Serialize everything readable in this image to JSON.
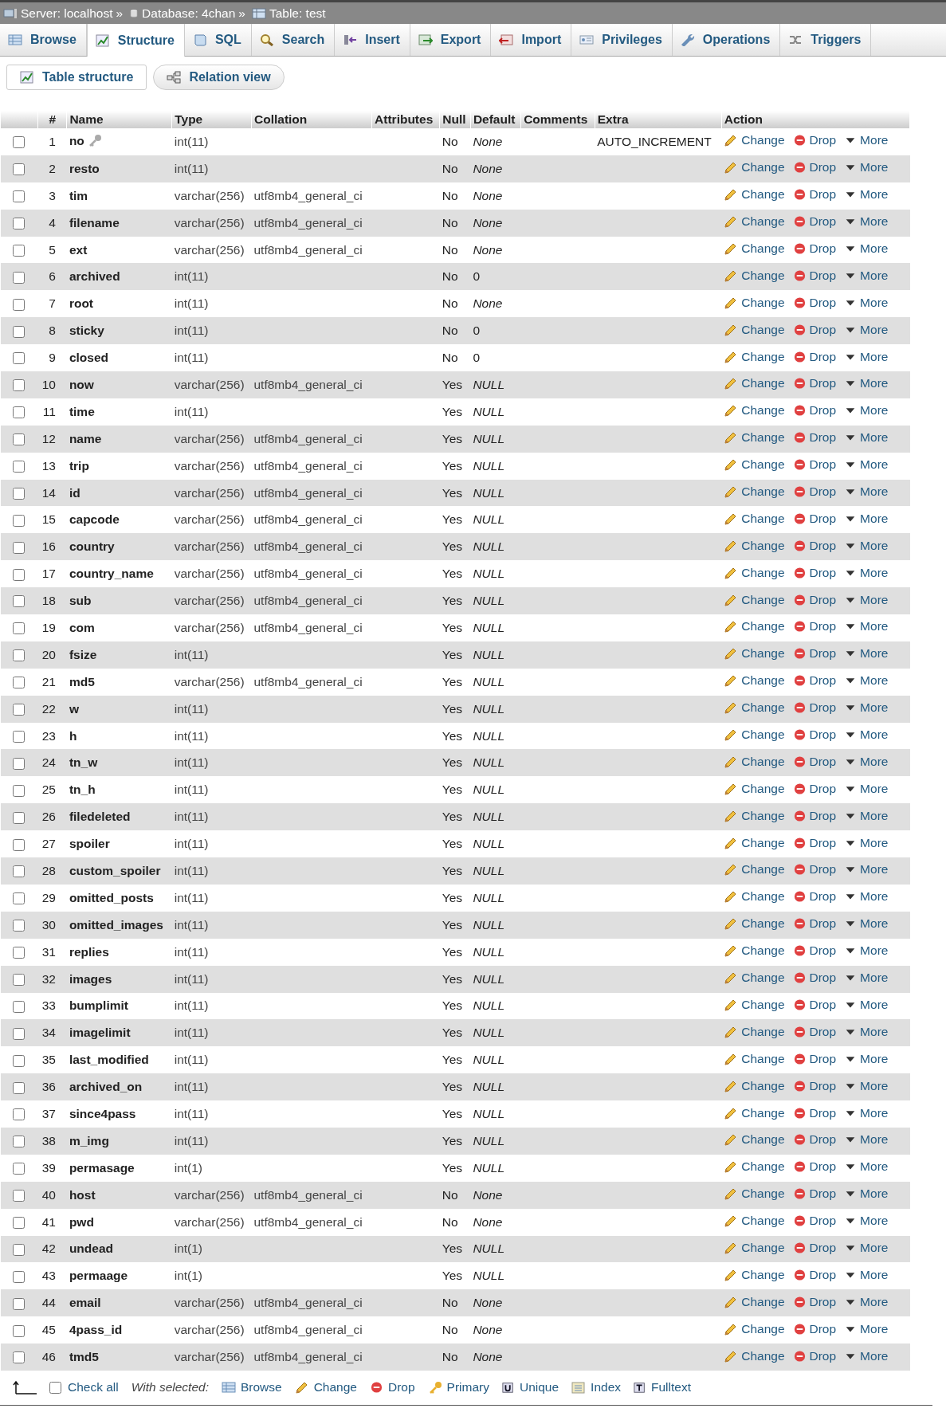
{
  "breadcrumb": [
    {
      "label": "Server: localhost",
      "kind": "server"
    },
    {
      "label": "Database: 4chan",
      "kind": "database"
    },
    {
      "label": "Table: test",
      "kind": "table"
    }
  ],
  "breadcrumb_separator": "»",
  "tabs": [
    {
      "label": "Browse",
      "selected": false
    },
    {
      "label": "Structure",
      "selected": true
    },
    {
      "label": "SQL",
      "selected": false
    },
    {
      "label": "Search",
      "selected": false
    },
    {
      "label": "Insert",
      "selected": false
    },
    {
      "label": "Export",
      "selected": false
    },
    {
      "label": "Import",
      "selected": false
    },
    {
      "label": "Privileges",
      "selected": false
    },
    {
      "label": "Operations",
      "selected": false
    },
    {
      "label": "Triggers",
      "selected": false
    }
  ],
  "subtabs": [
    {
      "label": "Table structure",
      "selected": true
    },
    {
      "label": "Relation view",
      "selected": false
    }
  ],
  "table": {
    "columns": [
      "#",
      "Name",
      "Type",
      "Collation",
      "Attributes",
      "Null",
      "Default",
      "Comments",
      "Extra",
      "Action"
    ],
    "rows": [
      {
        "num": "1",
        "name": "no",
        "type": "int(11)",
        "null": "No",
        "default": "None",
        "default_italic": true,
        "extra": "AUTO_INCREMENT",
        "primary": true,
        "checked": false,
        "change": "Change",
        "drop": "Drop",
        "more": "More"
      },
      {
        "num": "2",
        "name": "resto",
        "type": "int(11)",
        "null": "No",
        "default": "None",
        "default_italic": true,
        "primary": false,
        "checked": false,
        "change": "Change",
        "drop": "Drop",
        "more": "More"
      },
      {
        "num": "3",
        "name": "tim",
        "type": "varchar(256)",
        "collation": "utf8mb4_general_ci",
        "null": "No",
        "default": "None",
        "default_italic": true,
        "primary": false,
        "checked": false,
        "change": "Change",
        "drop": "Drop",
        "more": "More"
      },
      {
        "num": "4",
        "name": "filename",
        "type": "varchar(256)",
        "collation": "utf8mb4_general_ci",
        "null": "No",
        "default": "None",
        "default_italic": true,
        "primary": false,
        "checked": false,
        "change": "Change",
        "drop": "Drop",
        "more": "More"
      },
      {
        "num": "5",
        "name": "ext",
        "type": "varchar(256)",
        "collation": "utf8mb4_general_ci",
        "null": "No",
        "default": "None",
        "default_italic": true,
        "primary": false,
        "checked": false,
        "change": "Change",
        "drop": "Drop",
        "more": "More"
      },
      {
        "num": "6",
        "name": "archived",
        "type": "int(11)",
        "null": "No",
        "default": "0",
        "default_italic": false,
        "primary": false,
        "checked": false,
        "change": "Change",
        "drop": "Drop",
        "more": "More"
      },
      {
        "num": "7",
        "name": "root",
        "type": "int(11)",
        "null": "No",
        "default": "None",
        "default_italic": true,
        "primary": false,
        "checked": false,
        "change": "Change",
        "drop": "Drop",
        "more": "More"
      },
      {
        "num": "8",
        "name": "sticky",
        "type": "int(11)",
        "null": "No",
        "default": "0",
        "default_italic": false,
        "primary": false,
        "checked": false,
        "change": "Change",
        "drop": "Drop",
        "more": "More"
      },
      {
        "num": "9",
        "name": "closed",
        "type": "int(11)",
        "null": "No",
        "default": "0",
        "default_italic": false,
        "primary": false,
        "checked": false,
        "change": "Change",
        "drop": "Drop",
        "more": "More"
      },
      {
        "num": "10",
        "name": "now",
        "type": "varchar(256)",
        "collation": "utf8mb4_general_ci",
        "null": "Yes",
        "default": "NULL",
        "default_italic": true,
        "primary": false,
        "checked": false,
        "change": "Change",
        "drop": "Drop",
        "more": "More"
      },
      {
        "num": "11",
        "name": "time",
        "type": "int(11)",
        "null": "Yes",
        "default": "NULL",
        "default_italic": true,
        "primary": false,
        "checked": false,
        "change": "Change",
        "drop": "Drop",
        "more": "More"
      },
      {
        "num": "12",
        "name": "name",
        "type": "varchar(256)",
        "collation": "utf8mb4_general_ci",
        "null": "Yes",
        "default": "NULL",
        "default_italic": true,
        "primary": false,
        "checked": false,
        "change": "Change",
        "drop": "Drop",
        "more": "More"
      },
      {
        "num": "13",
        "name": "trip",
        "type": "varchar(256)",
        "collation": "utf8mb4_general_ci",
        "null": "Yes",
        "default": "NULL",
        "default_italic": true,
        "primary": false,
        "checked": false,
        "change": "Change",
        "drop": "Drop",
        "more": "More"
      },
      {
        "num": "14",
        "name": "id",
        "type": "varchar(256)",
        "collation": "utf8mb4_general_ci",
        "null": "Yes",
        "default": "NULL",
        "default_italic": true,
        "primary": false,
        "checked": false,
        "change": "Change",
        "drop": "Drop",
        "more": "More"
      },
      {
        "num": "15",
        "name": "capcode",
        "type": "varchar(256)",
        "collation": "utf8mb4_general_ci",
        "null": "Yes",
        "default": "NULL",
        "default_italic": true,
        "primary": false,
        "checked": false,
        "change": "Change",
        "drop": "Drop",
        "more": "More"
      },
      {
        "num": "16",
        "name": "country",
        "type": "varchar(256)",
        "collation": "utf8mb4_general_ci",
        "null": "Yes",
        "default": "NULL",
        "default_italic": true,
        "primary": false,
        "checked": false,
        "change": "Change",
        "drop": "Drop",
        "more": "More"
      },
      {
        "num": "17",
        "name": "country_name",
        "type": "varchar(256)",
        "collation": "utf8mb4_general_ci",
        "null": "Yes",
        "default": "NULL",
        "default_italic": true,
        "primary": false,
        "checked": false,
        "change": "Change",
        "drop": "Drop",
        "more": "More"
      },
      {
        "num": "18",
        "name": "sub",
        "type": "varchar(256)",
        "collation": "utf8mb4_general_ci",
        "null": "Yes",
        "default": "NULL",
        "default_italic": true,
        "primary": false,
        "checked": false,
        "change": "Change",
        "drop": "Drop",
        "more": "More"
      },
      {
        "num": "19",
        "name": "com",
        "type": "varchar(256)",
        "collation": "utf8mb4_general_ci",
        "null": "Yes",
        "default": "NULL",
        "default_italic": true,
        "primary": false,
        "checked": false,
        "change": "Change",
        "drop": "Drop",
        "more": "More"
      },
      {
        "num": "20",
        "name": "fsize",
        "type": "int(11)",
        "null": "Yes",
        "default": "NULL",
        "default_italic": true,
        "primary": false,
        "checked": false,
        "change": "Change",
        "drop": "Drop",
        "more": "More"
      },
      {
        "num": "21",
        "name": "md5",
        "type": "varchar(256)",
        "collation": "utf8mb4_general_ci",
        "null": "Yes",
        "default": "NULL",
        "default_italic": true,
        "primary": false,
        "checked": false,
        "change": "Change",
        "drop": "Drop",
        "more": "More"
      },
      {
        "num": "22",
        "name": "w",
        "type": "int(11)",
        "null": "Yes",
        "default": "NULL",
        "default_italic": true,
        "primary": false,
        "checked": false,
        "change": "Change",
        "drop": "Drop",
        "more": "More"
      },
      {
        "num": "23",
        "name": "h",
        "type": "int(11)",
        "null": "Yes",
        "default": "NULL",
        "default_italic": true,
        "primary": false,
        "checked": false,
        "change": "Change",
        "drop": "Drop",
        "more": "More"
      },
      {
        "num": "24",
        "name": "tn_w",
        "type": "int(11)",
        "null": "Yes",
        "default": "NULL",
        "default_italic": true,
        "primary": false,
        "checked": false,
        "change": "Change",
        "drop": "Drop",
        "more": "More"
      },
      {
        "num": "25",
        "name": "tn_h",
        "type": "int(11)",
        "null": "Yes",
        "default": "NULL",
        "default_italic": true,
        "primary": false,
        "checked": false,
        "change": "Change",
        "drop": "Drop",
        "more": "More"
      },
      {
        "num": "26",
        "name": "filedeleted",
        "type": "int(11)",
        "null": "Yes",
        "default": "NULL",
        "default_italic": true,
        "primary": false,
        "checked": false,
        "change": "Change",
        "drop": "Drop",
        "more": "More"
      },
      {
        "num": "27",
        "name": "spoiler",
        "type": "int(11)",
        "null": "Yes",
        "default": "NULL",
        "default_italic": true,
        "primary": false,
        "checked": false,
        "change": "Change",
        "drop": "Drop",
        "more": "More"
      },
      {
        "num": "28",
        "name": "custom_spoiler",
        "type": "int(11)",
        "null": "Yes",
        "default": "NULL",
        "default_italic": true,
        "primary": false,
        "checked": false,
        "change": "Change",
        "drop": "Drop",
        "more": "More"
      },
      {
        "num": "29",
        "name": "omitted_posts",
        "type": "int(11)",
        "null": "Yes",
        "default": "NULL",
        "default_italic": true,
        "primary": false,
        "checked": false,
        "change": "Change",
        "drop": "Drop",
        "more": "More"
      },
      {
        "num": "30",
        "name": "omitted_images",
        "type": "int(11)",
        "null": "Yes",
        "default": "NULL",
        "default_italic": true,
        "primary": false,
        "checked": false,
        "change": "Change",
        "drop": "Drop",
        "more": "More"
      },
      {
        "num": "31",
        "name": "replies",
        "type": "int(11)",
        "null": "Yes",
        "default": "NULL",
        "default_italic": true,
        "primary": false,
        "checked": false,
        "change": "Change",
        "drop": "Drop",
        "more": "More"
      },
      {
        "num": "32",
        "name": "images",
        "type": "int(11)",
        "null": "Yes",
        "default": "NULL",
        "default_italic": true,
        "primary": false,
        "checked": false,
        "change": "Change",
        "drop": "Drop",
        "more": "More"
      },
      {
        "num": "33",
        "name": "bumplimit",
        "type": "int(11)",
        "null": "Yes",
        "default": "NULL",
        "default_italic": true,
        "primary": false,
        "checked": false,
        "change": "Change",
        "drop": "Drop",
        "more": "More"
      },
      {
        "num": "34",
        "name": "imagelimit",
        "type": "int(11)",
        "null": "Yes",
        "default": "NULL",
        "default_italic": true,
        "primary": false,
        "checked": false,
        "change": "Change",
        "drop": "Drop",
        "more": "More"
      },
      {
        "num": "35",
        "name": "last_modified",
        "type": "int(11)",
        "null": "Yes",
        "default": "NULL",
        "default_italic": true,
        "primary": false,
        "checked": false,
        "change": "Change",
        "drop": "Drop",
        "more": "More"
      },
      {
        "num": "36",
        "name": "archived_on",
        "type": "int(11)",
        "null": "Yes",
        "default": "NULL",
        "default_italic": true,
        "primary": false,
        "checked": false,
        "change": "Change",
        "drop": "Drop",
        "more": "More"
      },
      {
        "num": "37",
        "name": "since4pass",
        "type": "int(11)",
        "null": "Yes",
        "default": "NULL",
        "default_italic": true,
        "primary": false,
        "checked": false,
        "change": "Change",
        "drop": "Drop",
        "more": "More"
      },
      {
        "num": "38",
        "name": "m_img",
        "type": "int(11)",
        "null": "Yes",
        "default": "NULL",
        "default_italic": true,
        "primary": false,
        "checked": false,
        "change": "Change",
        "drop": "Drop",
        "more": "More"
      },
      {
        "num": "39",
        "name": "permasage",
        "type": "int(1)",
        "null": "Yes",
        "default": "NULL",
        "default_italic": true,
        "primary": false,
        "checked": false,
        "change": "Change",
        "drop": "Drop",
        "more": "More"
      },
      {
        "num": "40",
        "name": "host",
        "type": "varchar(256)",
        "collation": "utf8mb4_general_ci",
        "null": "No",
        "default": "None",
        "default_italic": true,
        "primary": false,
        "checked": false,
        "change": "Change",
        "drop": "Drop",
        "more": "More"
      },
      {
        "num": "41",
        "name": "pwd",
        "type": "varchar(256)",
        "collation": "utf8mb4_general_ci",
        "null": "No",
        "default": "None",
        "default_italic": true,
        "primary": false,
        "checked": false,
        "change": "Change",
        "drop": "Drop",
        "more": "More"
      },
      {
        "num": "42",
        "name": "undead",
        "type": "int(1)",
        "null": "Yes",
        "default": "NULL",
        "default_italic": true,
        "primary": false,
        "checked": false,
        "change": "Change",
        "drop": "Drop",
        "more": "More"
      },
      {
        "num": "43",
        "name": "permaage",
        "type": "int(1)",
        "null": "Yes",
        "default": "NULL",
        "default_italic": true,
        "primary": false,
        "checked": false,
        "change": "Change",
        "drop": "Drop",
        "more": "More"
      },
      {
        "num": "44",
        "name": "email",
        "type": "varchar(256)",
        "collation": "utf8mb4_general_ci",
        "null": "No",
        "default": "None",
        "default_italic": true,
        "primary": false,
        "checked": false,
        "change": "Change",
        "drop": "Drop",
        "more": "More"
      },
      {
        "num": "45",
        "name": "4pass_id",
        "type": "varchar(256)",
        "collation": "utf8mb4_general_ci",
        "null": "No",
        "default": "None",
        "default_italic": true,
        "primary": false,
        "checked": false,
        "change": "Change",
        "drop": "Drop",
        "more": "More"
      },
      {
        "num": "46",
        "name": "tmd5",
        "type": "varchar(256)",
        "collation": "utf8mb4_general_ci",
        "null": "No",
        "default": "None",
        "default_italic": true,
        "primary": false,
        "checked": false,
        "change": "Change",
        "drop": "Drop",
        "more": "More"
      }
    ]
  },
  "footer": {
    "check_all": {
      "label": "Check all",
      "checked": false
    },
    "with_selected": "With selected:",
    "actions": [
      {
        "label": "Browse",
        "kind": "browse"
      },
      {
        "label": "Change",
        "kind": "change"
      },
      {
        "label": "Drop",
        "kind": "drop"
      },
      {
        "label": "Primary",
        "kind": "primary"
      },
      {
        "label": "Unique",
        "kind": "unique"
      },
      {
        "label": "Index",
        "kind": "index"
      },
      {
        "label": "Fulltext",
        "kind": "fulltext"
      }
    ]
  }
}
